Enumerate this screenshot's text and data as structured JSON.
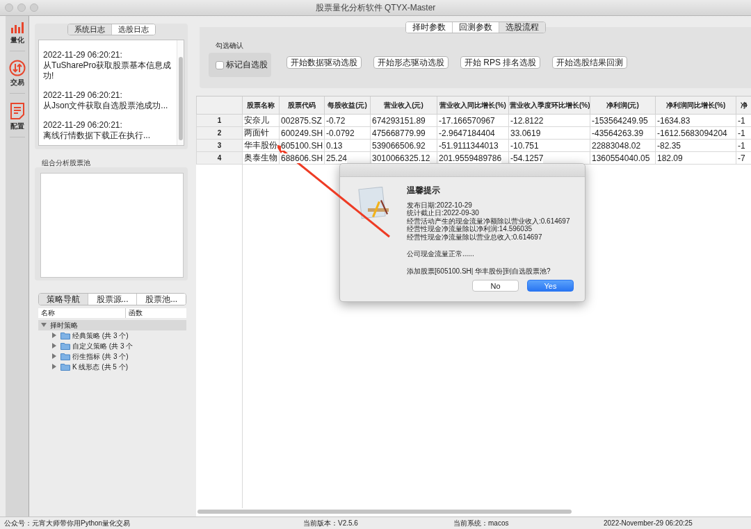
{
  "window": {
    "title": "股票量化分析软件 QTYX-Master"
  },
  "sidebar": {
    "items": [
      {
        "label": "量化",
        "kind": "chart"
      },
      {
        "label": "交易",
        "kind": "exchange"
      },
      {
        "label": "配置",
        "kind": "document"
      }
    ]
  },
  "log_panel": {
    "tabs": [
      {
        "label": "系统日志",
        "selected": true
      },
      {
        "label": "选股日志",
        "selected": false
      }
    ],
    "entries": [
      {
        "time": "2022-11-29 06:20:21:",
        "message": "从TuSharePro获取股票基本信息成功!"
      },
      {
        "time": "2022-11-29 06:20:21:",
        "message": "从Json文件获取自选股票池成功..."
      },
      {
        "time": "2022-11-29 06:20:21:",
        "message": "离线行情数据下载正在执行..."
      }
    ]
  },
  "pool_panel": {
    "title": "组合分析股票池"
  },
  "strategy_panel": {
    "tabs": [
      {
        "label": "策略导航",
        "selected": true
      },
      {
        "label": "股票源...",
        "selected": false
      },
      {
        "label": "股票池...",
        "selected": false
      }
    ],
    "tree": {
      "columns": [
        "名称",
        "函数"
      ],
      "items": [
        {
          "label": "择时策略",
          "expanded": true,
          "children": [
            {
              "label": "经典策略 (共 3 个)",
              "expanded": false
            },
            {
              "label": "自定义策略 (共 3 个",
              "expanded": false
            },
            {
              "label": "衍生指标 (共 3 个)",
              "expanded": false
            },
            {
              "label": "K 线形态 (共 5 个)",
              "expanded": false
            }
          ]
        }
      ]
    }
  },
  "selection_panel": {
    "tabs": [
      {
        "label": "择时参数",
        "selected": false
      },
      {
        "label": "回测参数",
        "selected": false
      },
      {
        "label": "选股流程",
        "selected": true
      }
    ],
    "confirm_group": {
      "title": "勾选确认",
      "checkbox": {
        "label": "标记自选股",
        "checked": false
      }
    },
    "buttons": [
      "开始数据驱动选股",
      "开始形态驱动选股",
      "开始 RPS 排名选股",
      "开始选股结果回测"
    ]
  },
  "table": {
    "columns": [
      "股票名称",
      "股票代码",
      "每股收益(元)",
      "营业收入(元)",
      "营业收入同比增长(%)",
      "营业收入季度环比增长(%)",
      "净利润(元)",
      "净利润同比增长(%)",
      "净"
    ],
    "rows": [
      {
        "number": "1",
        "cells": [
          "安奈儿",
          "002875.SZ",
          "-0.72",
          "674293151.89",
          "-17.166570967",
          "-12.8122",
          "-153564249.95",
          "-1634.83",
          "-1"
        ]
      },
      {
        "number": "2",
        "cells": [
          "两面针",
          "600249.SH",
          "-0.0792",
          "475668779.99",
          "-2.9647184404",
          "33.0619",
          "-43564263.39",
          "-1612.5683094204",
          "-1"
        ]
      },
      {
        "number": "3",
        "cells": [
          "华丰股份",
          "605100.SH",
          "0.13",
          "539066506.92",
          "-51.9111344013",
          "-10.751",
          "22883048.02",
          "-82.35",
          "-1"
        ]
      },
      {
        "number": "4",
        "cells": [
          "奥泰生物",
          "688606.SH",
          "25.24",
          "3010066325.12",
          "201.9559489786",
          "-54.1257",
          "1360554040.05",
          "182.09",
          "-7"
        ]
      }
    ]
  },
  "dialog": {
    "title": "温馨提示",
    "lines": [
      "发布日期:2022-10-29",
      "统计截止日:2022-09-30",
      "经营活动产生的现金流量净额除以营业收入:0.614697",
      "经营性现金净流量除以净利润:14.596035",
      "经营性现金净流量除以营业总收入:0.614697"
    ],
    "note": "公司现金流量正常......",
    "question": "添加股票[605100.SH| 华丰股份]到自选股票池?",
    "buttons": [
      {
        "label": "No",
        "default": false
      },
      {
        "label": "Yes",
        "default": true
      }
    ]
  },
  "status_bar": {
    "items": [
      "公众号：元宵大师带你用Python量化交易",
      "当前版本：V2.5.6",
      "当前系统：macos",
      "2022-November-29 06:20:25"
    ]
  }
}
